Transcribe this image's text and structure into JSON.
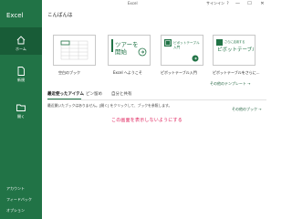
{
  "window": {
    "title": "Excel",
    "signin": "サインイン",
    "help": "?",
    "minimize": "—",
    "maximize": "☐",
    "close": "✕"
  },
  "sidebar": {
    "app_name": "Excel",
    "items": [
      {
        "label": "ホーム",
        "icon": "home-icon",
        "active": true
      },
      {
        "label": "新規",
        "icon": "new-file-icon",
        "active": false
      },
      {
        "label": "開く",
        "icon": "folder-icon",
        "active": false
      }
    ],
    "bottom": {
      "account": "アカウント",
      "feedback": "フィードバック",
      "options": "オプション"
    }
  },
  "main": {
    "greeting": "こんばんは",
    "templates": [
      {
        "label": "空白のブック"
      },
      {
        "label": "Excel へようこそ",
        "thumb_text": "ツアーを\n開始"
      },
      {
        "label": "ピボットテーブル入門",
        "thumb_text": "ピボットテーブル\n入門"
      },
      {
        "label": "ピボットテーブルをさらに...",
        "thumb_text": "さらに活用する\nピボットテーブル"
      }
    ],
    "more_templates": "その他のテンプレート →",
    "tabs": [
      {
        "label": "最近使ったアイテム",
        "active": true
      },
      {
        "label": "ピン留め",
        "active": false
      },
      {
        "label": "自分と共有",
        "active": false
      }
    ],
    "empty_message": "最近開いたブックはありません。[開く] をクリックして、ブックを参照します。",
    "more_workbooks": "その他のブック →",
    "annotation": "この画面を表示しないようにする"
  },
  "colors": {
    "nav_bg": "#217346",
    "nav_active": "#185c37",
    "accent": "#217346",
    "annotation": "#e0245e"
  }
}
